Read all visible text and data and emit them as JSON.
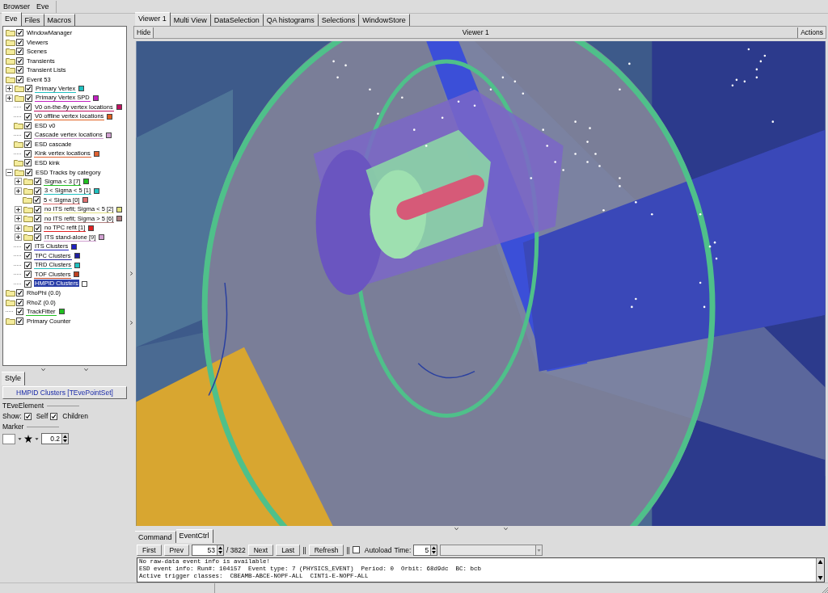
{
  "menu": [
    {
      "label": "Browser"
    },
    {
      "label": "Eve"
    }
  ],
  "left_tabs": [
    {
      "label": "Eve",
      "selected": true
    },
    {
      "label": "Files",
      "selected": false
    },
    {
      "label": "Macros",
      "selected": false
    }
  ],
  "tree": [
    {
      "label": "WindowManager",
      "kind": "folder",
      "checked": true,
      "selected": false
    },
    {
      "label": "Viewers",
      "kind": "folder",
      "checked": true,
      "selected": false
    },
    {
      "label": "Scenes",
      "kind": "folder",
      "checked": true,
      "selected": false
    },
    {
      "label": "Transients",
      "kind": "folder",
      "checked": true,
      "selected": false
    },
    {
      "label": "Transient Lists",
      "kind": "folder",
      "checked": true,
      "selected": false
    },
    {
      "label": "Event 53",
      "kind": "folder",
      "checked": true,
      "selected": false,
      "children": [
        {
          "label": "Primary Vertex",
          "kind": "folder",
          "checked": true,
          "selected": false,
          "expanded": false,
          "color": "#20c0c0"
        },
        {
          "label": "Primary Vertex SPD",
          "kind": "folder",
          "checked": true,
          "selected": false,
          "expanded": false,
          "color": "#c020c0"
        },
        {
          "label": "V0 on-the-fly vertex locations",
          "kind": "leaf",
          "checked": true,
          "selected": false,
          "color": "#c01060"
        },
        {
          "label": "V0 offline vertex locations",
          "kind": "leaf",
          "checked": true,
          "selected": false,
          "color": "#e06020"
        },
        {
          "label": "ESD v0",
          "kind": "folder",
          "checked": true,
          "selected": false
        },
        {
          "label": "Cascade vertex locations",
          "kind": "leaf",
          "checked": true,
          "selected": false,
          "color": "#d0a0d0"
        },
        {
          "label": "ESD cascade",
          "kind": "folder",
          "checked": true,
          "selected": false
        },
        {
          "label": "Kink vertex locations",
          "kind": "leaf",
          "checked": true,
          "selected": false,
          "color": "#e06030"
        },
        {
          "label": "ESD kink",
          "kind": "folder",
          "checked": true,
          "selected": false
        },
        {
          "label": "ESD Tracks by category",
          "kind": "folder",
          "checked": true,
          "selected": false,
          "expanded": true,
          "children": [
            {
              "label": "Sigma < 3 [7]",
              "kind": "folder",
              "checked": true,
              "selected": false,
              "expanded": false,
              "color": "#20c020"
            },
            {
              "label": "3 < Sigma < 5 [1]",
              "kind": "folder",
              "checked": true,
              "selected": false,
              "expanded": false,
              "color": "#20c0c0"
            },
            {
              "label": "5 < Sigma [0]",
              "kind": "folder",
              "checked": true,
              "selected": false,
              "color": "#e07070"
            },
            {
              "label": "no ITS refit; Sigma < 5 [2]",
              "kind": "folder",
              "checked": true,
              "selected": false,
              "expanded": false,
              "color": "#e0e080"
            },
            {
              "label": "no ITS refit; Sigma > 5 [6]",
              "kind": "folder",
              "checked": true,
              "selected": false,
              "expanded": false,
              "color": "#b08080"
            },
            {
              "label": "no TPC refit [1]",
              "kind": "folder",
              "checked": true,
              "selected": false,
              "expanded": false,
              "color": "#e02020"
            },
            {
              "label": "ITS stand-alone [9]",
              "kind": "folder",
              "checked": true,
              "selected": false,
              "expanded": false,
              "color": "#d0a0d0"
            }
          ]
        },
        {
          "label": "ITS Clusters",
          "kind": "leaf",
          "checked": true,
          "selected": false,
          "color": "#2020c0"
        },
        {
          "label": "TPC Clusters",
          "kind": "leaf",
          "checked": true,
          "selected": false,
          "color": "#2020a0"
        },
        {
          "label": "TRD Clusters",
          "kind": "leaf",
          "checked": true,
          "selected": false,
          "color": "#20c0c0"
        },
        {
          "label": "TOF Clusters",
          "kind": "leaf",
          "checked": true,
          "selected": false,
          "color": "#c04020"
        },
        {
          "label": "HMPID Clusters",
          "kind": "leaf",
          "checked": true,
          "selected": true,
          "color": "#ffffff"
        }
      ]
    },
    {
      "label": "RhoPhi (0.0)",
      "kind": "folder",
      "checked": true,
      "selected": false
    },
    {
      "label": "RhoZ (0.0)",
      "kind": "folder",
      "checked": true,
      "selected": false
    },
    {
      "label": "TrackFitter",
      "kind": "leaf",
      "checked": true,
      "selected": false,
      "color": "#20c020"
    },
    {
      "label": "Primary Counter",
      "kind": "folder",
      "checked": true,
      "selected": false
    }
  ],
  "style_panel": {
    "tabs": [
      {
        "label": "Style",
        "selected": true
      }
    ],
    "object_button": "HMPID Clusters [TEvePointSet]",
    "section_title": "TEveElement",
    "show_label": "Show:",
    "show_options": [
      {
        "label": "Self",
        "checked": true
      },
      {
        "label": "Children",
        "checked": true
      }
    ],
    "marker_title": "Marker",
    "marker_size": "0.2"
  },
  "viewer_tabs": [
    {
      "label": "Viewer 1",
      "selected": true
    },
    {
      "label": "Multi View",
      "selected": false
    },
    {
      "label": "DataSelection",
      "selected": false
    },
    {
      "label": "QA histograms",
      "selected": false
    },
    {
      "label": "Selections",
      "selected": false
    },
    {
      "label": "WindowStore",
      "selected": false
    }
  ],
  "viewer": {
    "hide_button": "Hide",
    "title": "Viewer 1",
    "actions_button": "Actions"
  },
  "bottom_tabs": [
    {
      "label": "Command",
      "selected": false
    },
    {
      "label": "EventCtrl",
      "selected": true
    }
  ],
  "event_controls": {
    "first": "First",
    "prev": "Prev",
    "event_number": "53",
    "event_total": "/ 3822",
    "next": "Next",
    "last": "Last",
    "separator_1": "||",
    "refresh": "Refresh",
    "separator_2": "||",
    "autoload": {
      "label": "Autoload",
      "checked": false
    },
    "time_label": "Time:",
    "time_value": "5"
  },
  "console_lines": [
    "No raw-data event info is available!",
    "ESD event info: Run#: 104157  Event type: 7 (PHYSICS_EVENT)  Period: 0  Orbit: 68d9dc  BC: bcb",
    "Active trigger classes:  CBEAMB-ABCE-NOPF-ALL  CINT1-E-NOPF-ALL"
  ]
}
